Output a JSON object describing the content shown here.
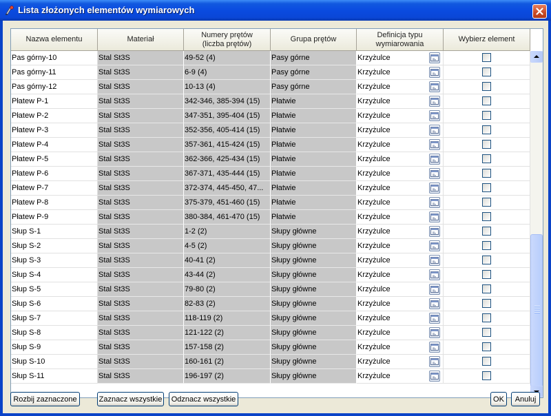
{
  "window": {
    "title": "Lista złożonych elementów wymiarowych",
    "close_label": "Zamknij"
  },
  "table": {
    "headers": {
      "name": "Nazwa elementu",
      "material": "Materiał",
      "bars_line1": "Numery prętów",
      "bars_line2": "(liczba prętów)",
      "group": "Grupa prętów",
      "def_line1": "Definicja typu",
      "def_line2": "wymiarowania",
      "select": "Wybierz element"
    },
    "rows": [
      {
        "name": "Pas górny-10",
        "material": "Stal St3S",
        "bars": "49-52 (4)",
        "group": "Pasy górne",
        "def": "Krzyżulce"
      },
      {
        "name": "Pas górny-11",
        "material": "Stal St3S",
        "bars": "6-9 (4)",
        "group": "Pasy górne",
        "def": "Krzyżulce"
      },
      {
        "name": "Pas górny-12",
        "material": "Stal St3S",
        "bars": "10-13 (4)",
        "group": "Pasy górne",
        "def": "Krzyżulce"
      },
      {
        "name": "Płatew P-1",
        "material": "Stal St3S",
        "bars": "342-346, 385-394 (15)",
        "group": "Płatwie",
        "def": "Krzyżulce"
      },
      {
        "name": "Płatew P-2",
        "material": "Stal St3S",
        "bars": "347-351, 395-404 (15)",
        "group": "Płatwie",
        "def": "Krzyżulce"
      },
      {
        "name": "Płatew P-3",
        "material": "Stal St3S",
        "bars": "352-356, 405-414 (15)",
        "group": "Płatwie",
        "def": "Krzyżulce"
      },
      {
        "name": "Płatew P-4",
        "material": "Stal St3S",
        "bars": "357-361, 415-424 (15)",
        "group": "Płatwie",
        "def": "Krzyżulce"
      },
      {
        "name": "Płatew P-5",
        "material": "Stal St3S",
        "bars": "362-366, 425-434 (15)",
        "group": "Płatwie",
        "def": "Krzyżulce"
      },
      {
        "name": "Płatew P-6",
        "material": "Stal St3S",
        "bars": "367-371, 435-444 (15)",
        "group": "Płatwie",
        "def": "Krzyżulce"
      },
      {
        "name": "Płatew P-7",
        "material": "Stal St3S",
        "bars": "372-374, 445-450, 47...",
        "group": "Płatwie",
        "def": "Krzyżulce"
      },
      {
        "name": "Płatew P-8",
        "material": "Stal St3S",
        "bars": "375-379, 451-460 (15)",
        "group": "Płatwie",
        "def": "Krzyżulce"
      },
      {
        "name": "Płatew P-9",
        "material": "Stal St3S",
        "bars": "380-384, 461-470 (15)",
        "group": "Płatwie",
        "def": "Krzyżulce"
      },
      {
        "name": "Słup S-1",
        "material": "Stal St3S",
        "bars": "1-2 (2)",
        "group": "Słupy główne",
        "def": "Krzyżulce"
      },
      {
        "name": "Słup S-2",
        "material": "Stal St3S",
        "bars": "4-5 (2)",
        "group": "Słupy główne",
        "def": "Krzyżulce"
      },
      {
        "name": "Słup S-3",
        "material": "Stal St3S",
        "bars": "40-41 (2)",
        "group": "Słupy główne",
        "def": "Krzyżulce"
      },
      {
        "name": "Słup S-4",
        "material": "Stal St3S",
        "bars": "43-44 (2)",
        "group": "Słupy główne",
        "def": "Krzyżulce"
      },
      {
        "name": "Słup S-5",
        "material": "Stal St3S",
        "bars": "79-80 (2)",
        "group": "Słupy główne",
        "def": "Krzyżulce"
      },
      {
        "name": "Słup S-6",
        "material": "Stal St3S",
        "bars": "82-83 (2)",
        "group": "Słupy główne",
        "def": "Krzyżulce"
      },
      {
        "name": "Słup S-7",
        "material": "Stal St3S",
        "bars": "118-119 (2)",
        "group": "Słupy główne",
        "def": "Krzyżulce"
      },
      {
        "name": "Słup S-8",
        "material": "Stal St3S",
        "bars": "121-122 (2)",
        "group": "Słupy główne",
        "def": "Krzyżulce"
      },
      {
        "name": "Słup S-9",
        "material": "Stal St3S",
        "bars": "157-158 (2)",
        "group": "Słupy główne",
        "def": "Krzyżulce"
      },
      {
        "name": "Słup S-10",
        "material": "Stal St3S",
        "bars": "160-161 (2)",
        "group": "Słupy główne",
        "def": "Krzyżulce"
      },
      {
        "name": "Słup S-11",
        "material": "Stal St3S",
        "bars": "196-197 (2)",
        "group": "Słupy główne",
        "def": "Krzyżulce"
      }
    ]
  },
  "buttons": {
    "split": "Rozbij zaznaczone",
    "select_all": "Zaznacz wszystkie",
    "deselect_all": "Odznacz wszystkie",
    "ok": "OK",
    "cancel": "Anuluj"
  },
  "colors": {
    "titlebar": "#0a4be0",
    "dialog_bg": "#ece9d8",
    "readonly_cell": "#c8c8c8"
  },
  "icons": {
    "title": "app-icon",
    "close": "close-icon",
    "definition_edit": "edit-definition-icon",
    "scroll_up": "arrow-up-icon",
    "scroll_down": "arrow-down-icon"
  }
}
